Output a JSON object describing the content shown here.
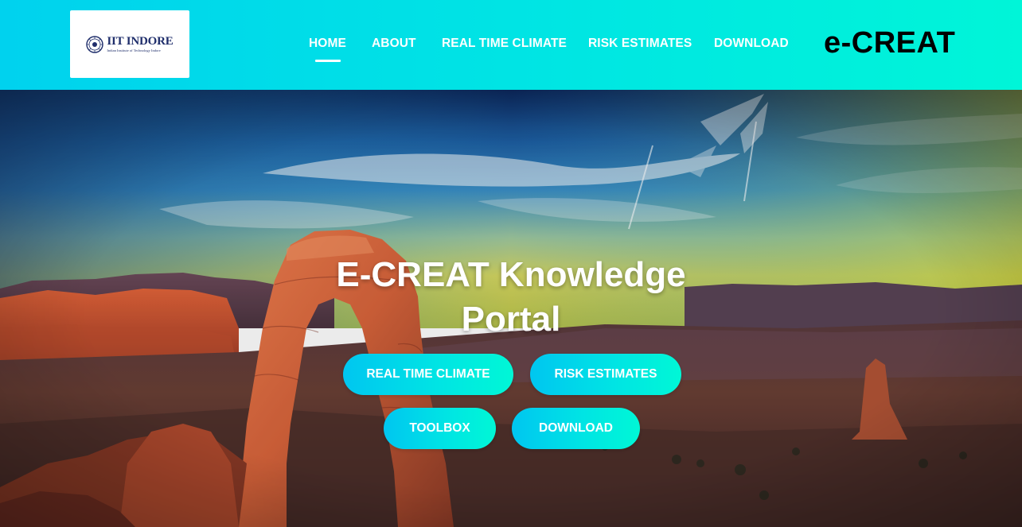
{
  "header": {
    "logo": {
      "title": "IIT INDORE",
      "subtitle": "Indian Institute of Technology Indore"
    },
    "nav": [
      {
        "label": "HOME",
        "active": true
      },
      {
        "label": "ABOUT",
        "active": false
      },
      {
        "label": "REAL TIME CLIMATE",
        "active": false
      },
      {
        "label": "RISK ESTIMATES",
        "active": false
      },
      {
        "label": "DOWNLOAD",
        "active": false
      }
    ],
    "brand": "e-CREAT"
  },
  "hero": {
    "title_line1": "E-CREAT Knowledge",
    "title_line2": "Portal",
    "buttons": [
      {
        "label": "REAL TIME CLIMATE"
      },
      {
        "label": "RISK ESTIMATES"
      },
      {
        "label": "TOOLBOX"
      },
      {
        "label": "DOWNLOAD"
      }
    ]
  },
  "colors": {
    "header_gradient_start": "#00d2ee",
    "header_gradient_end": "#00f5d8",
    "button_gradient_start": "#00c6f0",
    "button_gradient_end": "#00f7d6",
    "logo_text": "#1f2e6b"
  }
}
